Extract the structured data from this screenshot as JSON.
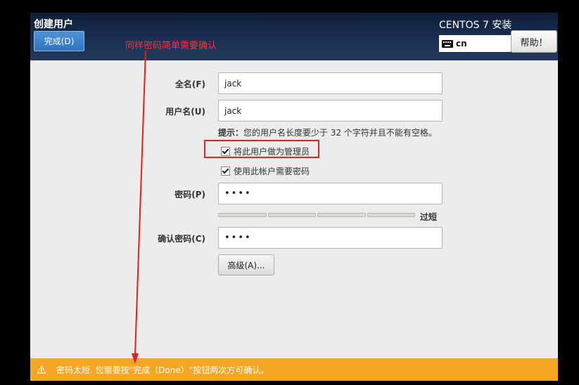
{
  "header": {
    "title": "创建用户",
    "done_label": "完成(D)",
    "product": "CENTOS 7 安装",
    "keyboard_layout": "cn",
    "help_label": "帮助！"
  },
  "annotation": {
    "text": "同样密码简单需要确认",
    "color": "#ff3333"
  },
  "form": {
    "fullname_label": "全名(F)",
    "fullname_value": "jack",
    "username_label": "用户名(U)",
    "username_value": "jack",
    "hint_label": "提示：",
    "hint_text": "您的用户名长度要少于 32 个字符并且不能有空格。",
    "admin_checkbox": {
      "label": "将此用户做为管理员",
      "checked": true
    },
    "require_password_checkbox": {
      "label": "使用此帐户需要密码",
      "checked": true
    },
    "password_label": "密码(P)",
    "password_value": "••••",
    "strength_label": "过短",
    "strength_fraction": 0,
    "confirm_label": "确认密码(C)",
    "confirm_value": "••••",
    "advanced_label": "高级(A)..."
  },
  "warning": {
    "text": "密码太短. 您需要按\"完成（Done）\"按钮两次方可确认。",
    "icon": "warning-triangle-icon",
    "color": "#f5a623"
  },
  "colors": {
    "header": "#1a2f52",
    "button_blue": "#3a7fc8",
    "highlight": "#e02222"
  }
}
